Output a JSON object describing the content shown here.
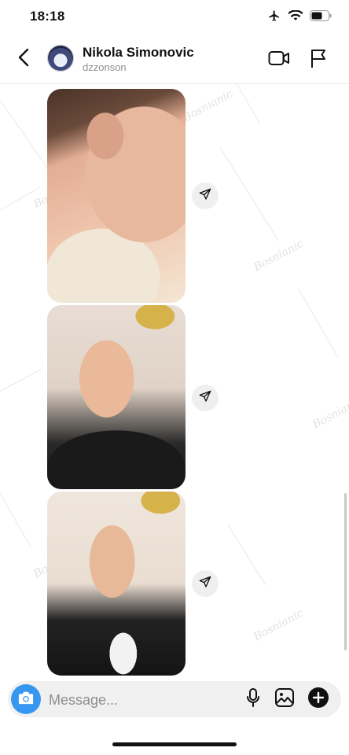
{
  "status_bar": {
    "time": "18:18"
  },
  "header": {
    "name": "Nikola Simonovic",
    "username": "dzzonson"
  },
  "messages": [
    {
      "type": "photo",
      "description": "selfie-ear-close-up"
    },
    {
      "type": "photo",
      "description": "selfie-lying-pillow"
    },
    {
      "type": "photo",
      "description": "selfie-black-shirt"
    }
  ],
  "composer": {
    "placeholder": "Message..."
  },
  "icons": {
    "back": "chevron-left-icon",
    "video": "video-camera-icon",
    "flag": "flag-icon",
    "share": "paper-plane-icon",
    "camera": "camera-icon",
    "mic": "microphone-icon",
    "gallery": "image-icon",
    "plus": "plus-circle-icon"
  },
  "colors": {
    "accent": "#3797f0",
    "background": "#ffffff",
    "secondary_text": "#8e8e8e"
  }
}
